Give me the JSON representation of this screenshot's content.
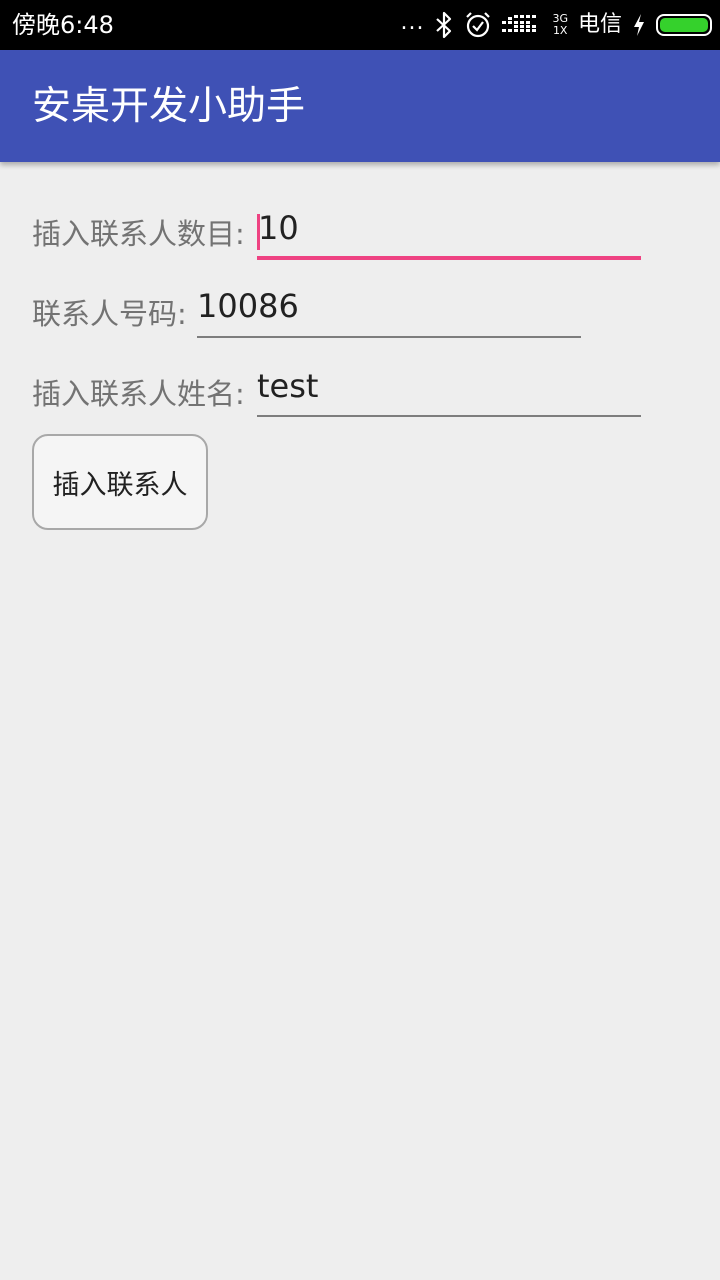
{
  "status_bar": {
    "time": "傍晚6:48",
    "dots": "...",
    "network_type_top": "3G",
    "network_type_bottom": "1X",
    "carrier": "电信",
    "battery_level_percent": 100,
    "icons": [
      "bluetooth-icon",
      "alarm-icon",
      "signal-icon",
      "charging-icon",
      "battery-icon"
    ]
  },
  "app_bar": {
    "title": "安桌开发小助手",
    "color": "#3f51b5"
  },
  "form": {
    "count_label": "插入联系人数目:",
    "count_value": "10",
    "phone_label": "联系人号码:",
    "phone_value": "10086",
    "name_label": "插入联系人姓名:",
    "name_value": "test",
    "accent_color": "#ee4282"
  },
  "button": {
    "insert_label": "插入联系人"
  }
}
